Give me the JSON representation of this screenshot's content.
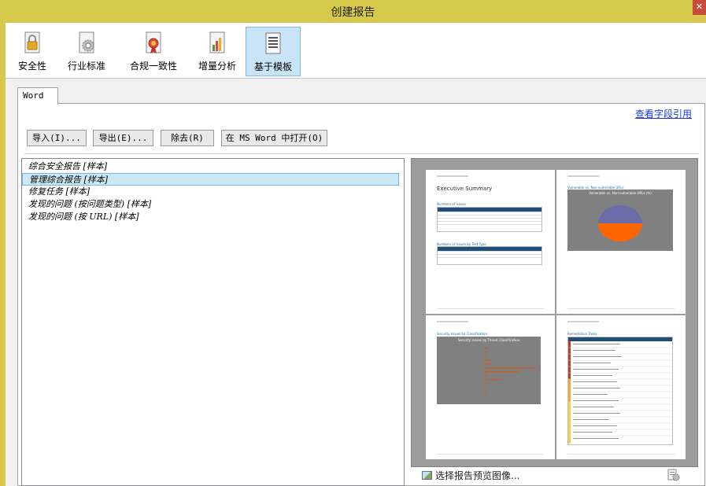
{
  "window": {
    "title": "创建报告"
  },
  "toolbar": {
    "items": [
      {
        "label": "安全性",
        "icon": "lock-icon"
      },
      {
        "label": "行业标准",
        "icon": "gear-document-icon"
      },
      {
        "label": "合规一致性",
        "icon": "award-document-icon"
      },
      {
        "label": "增量分析",
        "icon": "chart-document-icon"
      },
      {
        "label": "基于模板",
        "icon": "template-document-icon",
        "selected": true
      }
    ]
  },
  "tabs": [
    {
      "label": "Word"
    }
  ],
  "links": {
    "field_reference": "查看字段引用"
  },
  "actions": {
    "import": "导入(I)...",
    "export": "导出(E)...",
    "remove": "除去(R)",
    "open_word": "在 MS Word 中打开(O)"
  },
  "templates": [
    {
      "label": "综合安全报告 [样本]"
    },
    {
      "label": "管理综合报告 [样本]",
      "selected": true
    },
    {
      "label": "修复任务 [样本]"
    },
    {
      "label": "发现的问题 (按问题类型) [样本]"
    },
    {
      "label": "发现的问题 (按 URL) [样本]"
    }
  ],
  "preview": {
    "pages": [
      {
        "heading": "Executive Summary",
        "sub1": "Numbers of Issues",
        "sub2": "Numbers of Issues by Test Type"
      },
      {
        "heading": "Vulnerable vs. Non-vulnerable URLs",
        "chart_title": "Vulnerable vs. Non-vulnerable URLs (%)"
      },
      {
        "heading": "Security Issues by Classification",
        "chart_title": "Security Issues by Threat Classification"
      },
      {
        "heading": "Remediation Tasks"
      }
    ],
    "select_image": "选择报告预览图像...",
    "colors": {
      "pie_top": "#6b6ba8",
      "pie_bottom": "#ff6600",
      "panel_bg": "#808080",
      "table_header": "#1f4e79"
    }
  }
}
